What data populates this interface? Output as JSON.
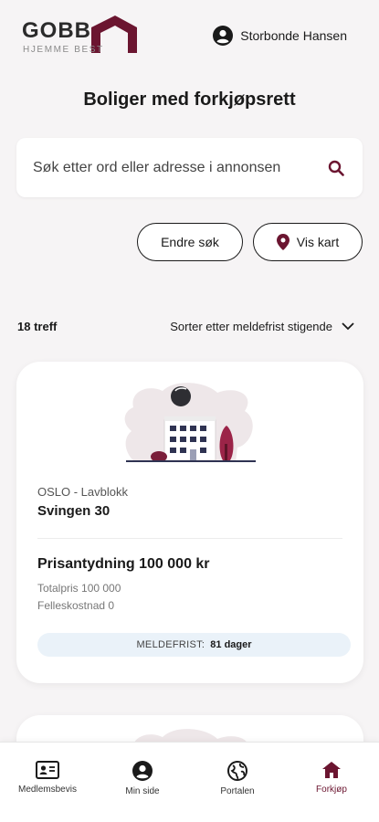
{
  "brand": {
    "name": "GOBB",
    "tagline": "HJEMME BEST"
  },
  "user": {
    "name": "Storbonde Hansen"
  },
  "page": {
    "title": "Boliger med forkjøpsrett"
  },
  "search": {
    "placeholder": "Søk etter ord eller adresse i annonsen"
  },
  "actions": {
    "change_search": "Endre søk",
    "show_map": "Vis kart"
  },
  "results": {
    "count_label": "18 treff",
    "sort_label": "Sorter etter meldefrist stigende"
  },
  "listing": {
    "location": "OSLO - Lavblokk",
    "address": "Svingen 30",
    "price": "Prisantydning 100 000 kr",
    "total_price": "Totalpris 100 000",
    "shared_cost": "Felleskostnad 0",
    "deadline_label": "MELDEFRIST:",
    "deadline_value": "81 dager"
  },
  "tabs": [
    {
      "label": "Medlemsbevis",
      "icon": "id-card-icon"
    },
    {
      "label": "Min side",
      "icon": "user-circle-icon"
    },
    {
      "label": "Portalen",
      "icon": "globe-icon"
    },
    {
      "label": "Forkjøp",
      "icon": "home-icon",
      "active": true
    }
  ],
  "colors": {
    "brand": "#6b1530",
    "background": "#f6f4f5",
    "deadline_bg": "#eaf2f9"
  }
}
